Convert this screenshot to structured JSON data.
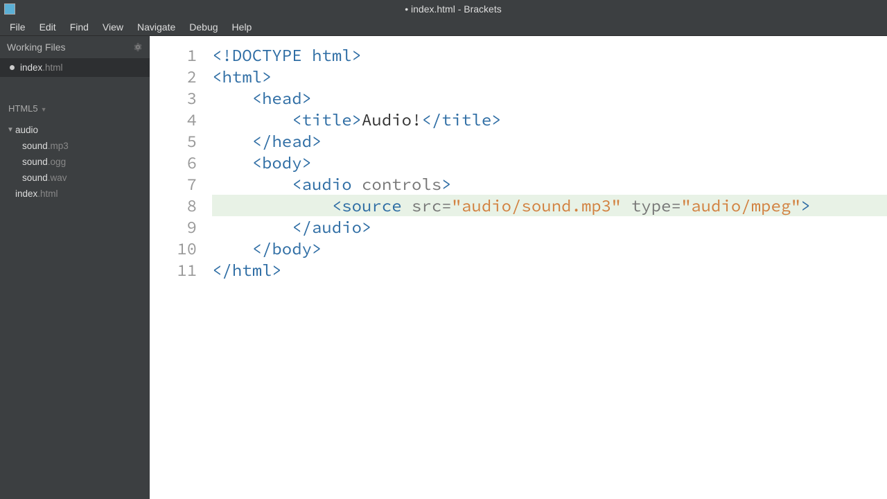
{
  "titlebar": {
    "title": "• index.html - Brackets"
  },
  "menubar": {
    "items": [
      "File",
      "Edit",
      "Find",
      "View",
      "Navigate",
      "Debug",
      "Help"
    ]
  },
  "sidebar": {
    "workingFiles": {
      "header": "Working Files",
      "items": [
        {
          "name": "index",
          "ext": ".html",
          "dirty": true
        }
      ]
    },
    "languageSelector": "HTML5",
    "tree": {
      "folder": "audio",
      "children": [
        {
          "name": "sound",
          "ext": ".mp3"
        },
        {
          "name": "sound",
          "ext": ".ogg"
        },
        {
          "name": "sound",
          "ext": ".wav"
        }
      ],
      "rootFile": {
        "name": "index",
        "ext": ".html"
      }
    }
  },
  "editor": {
    "lineNumbers": [
      "1",
      "2",
      "3",
      "4",
      "5",
      "6",
      "7",
      "8",
      "9",
      "10",
      "11"
    ],
    "lines": [
      {
        "indent": 0,
        "segments": [
          {
            "cls": "tag",
            "t": "<!DOCTYPE html>"
          }
        ]
      },
      {
        "indent": 0,
        "segments": [
          {
            "cls": "tag",
            "t": "<html>"
          }
        ]
      },
      {
        "indent": 1,
        "segments": [
          {
            "cls": "tag",
            "t": "<head>"
          }
        ]
      },
      {
        "indent": 2,
        "segments": [
          {
            "cls": "tag",
            "t": "<title>"
          },
          {
            "cls": "txt",
            "t": "Audio!"
          },
          {
            "cls": "tag",
            "t": "</title>"
          }
        ]
      },
      {
        "indent": 1,
        "segments": [
          {
            "cls": "tag",
            "t": "</head>"
          }
        ]
      },
      {
        "indent": 1,
        "segments": [
          {
            "cls": "tag",
            "t": "<body>"
          }
        ]
      },
      {
        "indent": 2,
        "segments": [
          {
            "cls": "tag",
            "t": "<audio "
          },
          {
            "cls": "attr",
            "t": "controls"
          },
          {
            "cls": "tag",
            "t": ">"
          }
        ]
      },
      {
        "indent": 3,
        "hl": true,
        "segments": [
          {
            "cls": "tag",
            "t": "<source "
          },
          {
            "cls": "attr",
            "t": "src="
          },
          {
            "cls": "str",
            "t": "\"audio/sound.mp3\""
          },
          {
            "cls": "txt",
            "t": " "
          },
          {
            "cls": "attr",
            "t": "type="
          },
          {
            "cls": "str",
            "t": "\"audio/mpeg\""
          },
          {
            "cls": "tag",
            "t": ">"
          }
        ]
      },
      {
        "indent": 2,
        "segments": [
          {
            "cls": "tag",
            "t": "</audio>"
          }
        ]
      },
      {
        "indent": 1,
        "segments": [
          {
            "cls": "tag",
            "t": "</body>"
          }
        ]
      },
      {
        "indent": 0,
        "segments": [
          {
            "cls": "tag",
            "t": "</html>"
          }
        ]
      }
    ]
  }
}
